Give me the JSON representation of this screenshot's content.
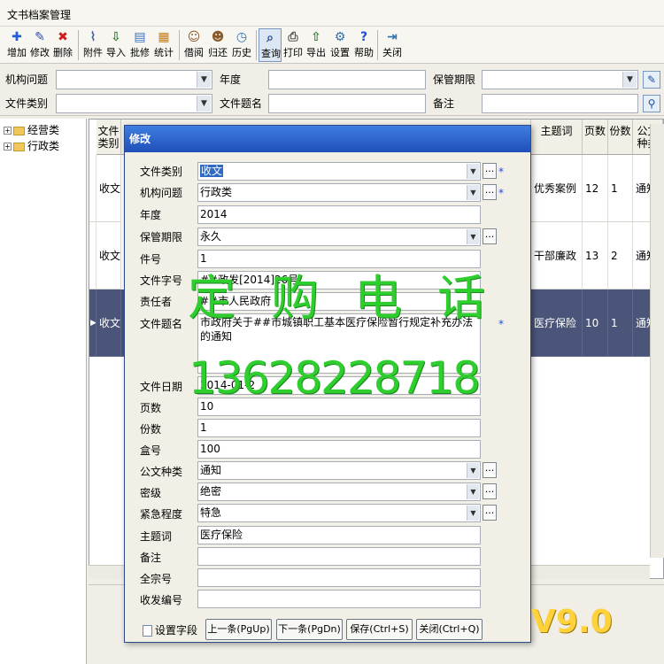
{
  "window": {
    "title": "文书档案管理"
  },
  "toolbar": {
    "buttons": [
      {
        "label": "增加",
        "icon": "plus-icon"
      },
      {
        "label": "修改",
        "icon": "pencil-icon"
      },
      {
        "label": "删除",
        "icon": "delete-x-icon"
      },
      {
        "label": "附件",
        "icon": "paperclip-icon"
      },
      {
        "label": "导入",
        "icon": "import-icon"
      },
      {
        "label": "批修",
        "icon": "batch-edit-icon"
      },
      {
        "label": "统计",
        "icon": "clipboard-icon"
      },
      {
        "label": "借阅",
        "icon": "user-icon"
      },
      {
        "label": "归还",
        "icon": "return-icon"
      },
      {
        "label": "历史",
        "icon": "clock-icon"
      },
      {
        "label": "查询",
        "icon": "magnifier-icon"
      },
      {
        "label": "打印",
        "icon": "printer-icon"
      },
      {
        "label": "导出",
        "icon": "export-icon"
      },
      {
        "label": "设置",
        "icon": "settings-icon"
      },
      {
        "label": "帮助",
        "icon": "help-icon"
      },
      {
        "label": "关闭",
        "icon": "exit-door-icon"
      }
    ]
  },
  "filters": {
    "org_issue_label": "机构问题",
    "year_label": "年度",
    "retention_label": "保管期限",
    "doc_type_label": "文件类别",
    "doc_title_label": "文件题名",
    "remarks_label": "备注"
  },
  "tree": {
    "items": [
      "经营类",
      "行政类"
    ]
  },
  "grid": {
    "columns": {
      "doc_type": "文件类别",
      "subject": "主题词",
      "pages": "页数",
      "copies": "份数",
      "doc_kind": "公文种类"
    },
    "rows": [
      {
        "doc_type": "收文",
        "subject": "优秀案例",
        "pages": "12",
        "copies": "1",
        "doc_kind": "通知"
      },
      {
        "doc_type": "收文",
        "subject": "干部廉政",
        "pages": "13",
        "copies": "2",
        "doc_kind": "通知"
      },
      {
        "doc_type": "收文",
        "subject": "医疗保险",
        "pages": "10",
        "copies": "1",
        "doc_kind": "通知"
      }
    ]
  },
  "modal": {
    "title": "修改",
    "labels": {
      "doc_type": "文件类别",
      "org_issue": "机构问题",
      "year": "年度",
      "retention": "保管期限",
      "item_no": "件号",
      "doc_no": "文件字号",
      "responsible": "责任者",
      "doc_title": "文件题名",
      "doc_date": "文件日期",
      "pages": "页数",
      "copies": "份数",
      "box_no": "盒号",
      "doc_kind": "公文种类",
      "secrecy": "密级",
      "urgency": "紧急程度",
      "subject": "主题词",
      "remarks": "备注",
      "fonds_no": "全宗号",
      "send_no": "收发编号"
    },
    "values": {
      "doc_type": "收文",
      "org_issue": "行政类",
      "year": "2014",
      "retention": "永久",
      "item_no": "1",
      "doc_no": "##政发[2014]26号",
      "responsible": "##市人民政府",
      "doc_title": "市政府关于##市城镇职工基本医疗保险暂行规定补充办法的通知",
      "doc_date": "2014-01-2",
      "pages": "10",
      "copies": "1",
      "box_no": "100",
      "doc_kind": "通知",
      "secrecy": "绝密",
      "urgency": "特急",
      "subject": "医疗保险",
      "remarks": "",
      "fonds_no": "",
      "send_no": ""
    },
    "dots": "...",
    "required_mark": "*",
    "buttons": {
      "set_fields": "设置字段",
      "prev": "上一条(PgUp)",
      "next": "下一条(PgDn)",
      "save": "保存(Ctrl+S)",
      "close": "关闭(Ctrl+Q)"
    }
  },
  "watermark": {
    "phone_label": "定购电话",
    "phone": "13628228718",
    "version": "V9.0"
  },
  "colors": {
    "accent": "#1f4fb8",
    "selection_row": "#4a5579",
    "watermark": "#2fce2f",
    "version": "#ffd23a"
  }
}
